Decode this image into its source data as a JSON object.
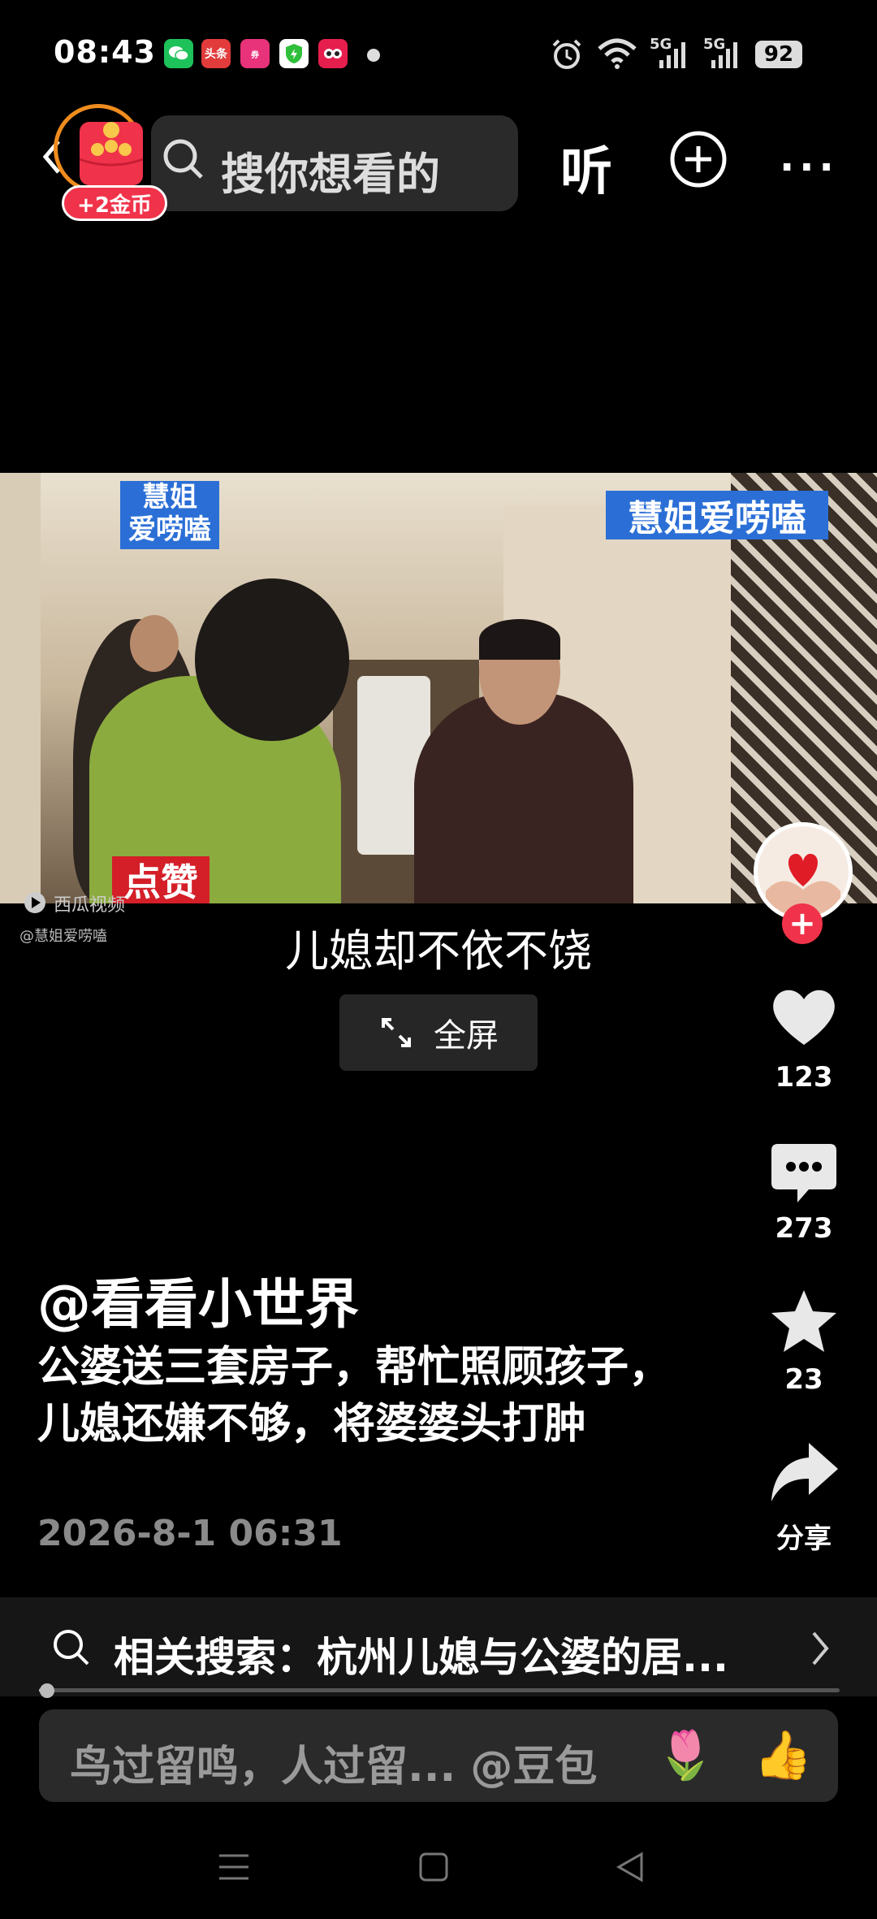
{
  "status": {
    "time": "08:43",
    "apps": [
      {
        "name": "wechat-icon",
        "label": "",
        "color": "#1ec25a"
      },
      {
        "name": "toutiao-icon",
        "label": "头条",
        "color": "#e23b3b"
      },
      {
        "name": "coupon-app-icon",
        "label": "",
        "color": "#e8327a"
      },
      {
        "name": "security-icon",
        "label": "",
        "color": "#2fbf3a"
      },
      {
        "name": "douyin-icon",
        "label": "",
        "color": "#e61e4d"
      }
    ],
    "signal_1": "5G",
    "signal_2": "5G",
    "battery": "92"
  },
  "topbar": {
    "coin_label": "+2金币",
    "search_placeholder": "搜你想看的",
    "listen_label": "听",
    "more_label": "···"
  },
  "video": {
    "watermark_left": "慧姐\n爱唠嗑",
    "watermark_right": "慧姐爱唠嗑",
    "like_stamp": "点赞",
    "platform": "西瓜视频",
    "platform_user": "@慧姐爱唠嗑",
    "subtitle": "儿媳却不依不饶"
  },
  "fullscreen": {
    "label": "全屏"
  },
  "rail": {
    "likes": "123",
    "comments": "273",
    "favorites": "23",
    "share_label": "分享"
  },
  "post": {
    "author": "@看看小世界",
    "caption": "公婆送三套房子，帮忙照顾孩子，儿媳还嫌不够，将婆婆头打肿",
    "date": "2026-8-1 06:31"
  },
  "related": {
    "text": "相关搜索：杭州儿媳与公婆的居..."
  },
  "progress": {
    "fraction": 0.005
  },
  "comment": {
    "placeholder": "鸟过留鸣，人过留... @豆包",
    "emoji_1": "🌷",
    "emoji_2": "👍"
  },
  "colors": {
    "accent": "#f0334a",
    "coin_ring": "#f08c1e",
    "watermark_blue": "#2b6fd6"
  }
}
